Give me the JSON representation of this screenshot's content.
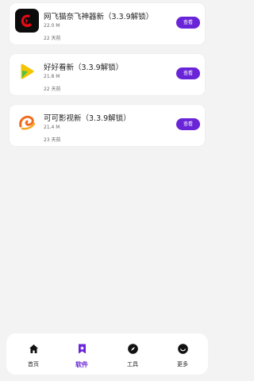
{
  "apps": [
    {
      "name": "网飞猫奈飞神器新（3.3.9解锁）",
      "size": "22.0 M",
      "time": "22 天前",
      "button": "查看",
      "icon": "netflix-c-icon"
    },
    {
      "name": "好好看新（3.3.9解锁）",
      "size": "21.8 M",
      "time": "22 天前",
      "button": "查看",
      "icon": "haohaokan-icon"
    },
    {
      "name": "可可影视新（3.3.9解锁）",
      "size": "21.4 M",
      "time": "23 天前",
      "button": "查看",
      "icon": "keke-icon"
    }
  ],
  "tabs": [
    {
      "label": "首页",
      "icon": "home-icon",
      "active": false
    },
    {
      "label": "软件",
      "icon": "bookmark-star-icon",
      "active": true
    },
    {
      "label": "工具",
      "icon": "compass-icon",
      "active": false
    },
    {
      "label": "更多",
      "icon": "smile-icon",
      "active": false
    }
  ],
  "colors": {
    "accent": "#6a24d8",
    "background": "#f3f3f3"
  }
}
